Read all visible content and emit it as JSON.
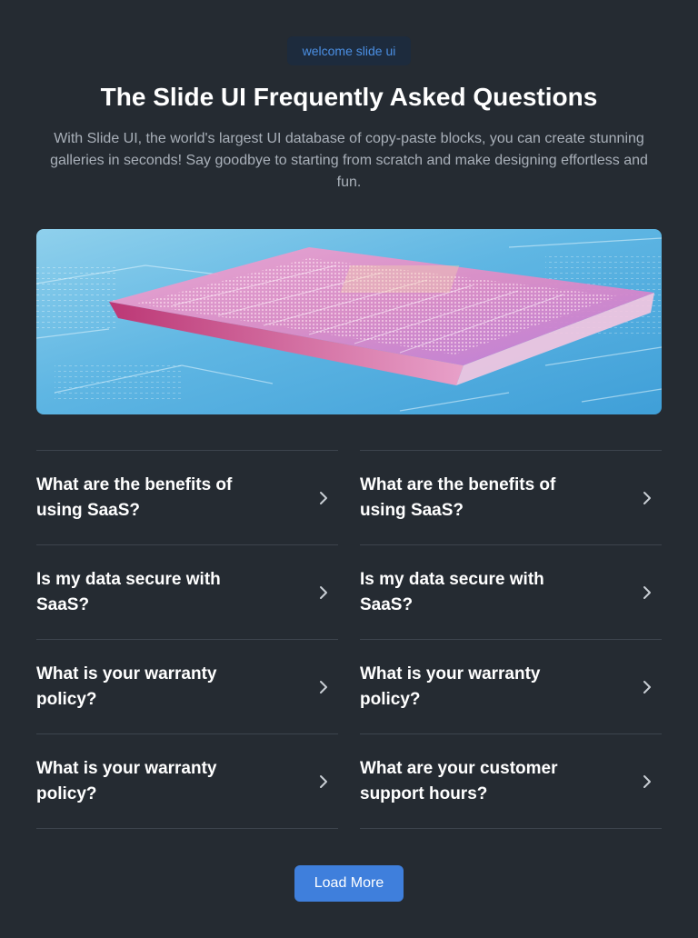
{
  "header": {
    "badge": "welcome slide ui",
    "title": "The Slide UI Frequently Asked Questions",
    "subtitle": "With Slide UI, the world's largest UI database of copy-paste blocks, you can create stunning galleries in seconds! Say goodbye to starting from scratch and make designing effortless and fun."
  },
  "hero": {
    "icon": "circuit-chip-illustration"
  },
  "faq": {
    "left": [
      {
        "question": "What are the benefits of using SaaS?"
      },
      {
        "question": "Is my data secure with SaaS?"
      },
      {
        "question": "What is your warranty policy?"
      },
      {
        "question": "What is your warranty policy?"
      }
    ],
    "right": [
      {
        "question": "What are the benefits of using SaaS?"
      },
      {
        "question": "Is my data secure with SaaS?"
      },
      {
        "question": "What is your warranty policy?"
      },
      {
        "question": "What are your customer support hours?"
      }
    ],
    "chevron_icon": "chevron-right-icon"
  },
  "actions": {
    "load_more": "Load More"
  },
  "colors": {
    "background": "#252b32",
    "accent": "#3f7fdc",
    "badge_text": "#4b8fe3",
    "divider": "#3d444d"
  }
}
